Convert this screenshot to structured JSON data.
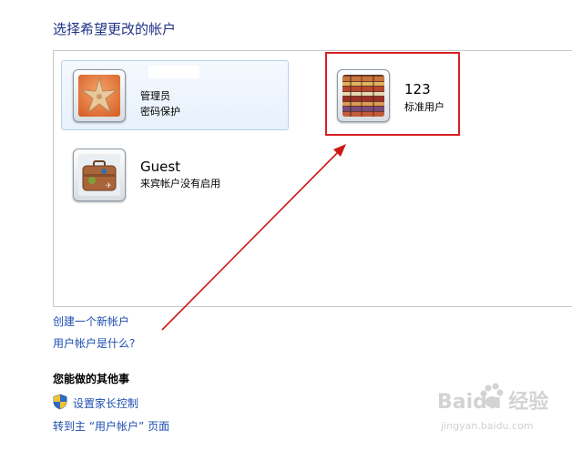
{
  "page": {
    "title": "选择希望更改的帐户"
  },
  "accounts": [
    {
      "name": "",
      "type": "管理员",
      "status": "密码保护",
      "icon": "starfish-icon",
      "selected": true
    },
    {
      "name": "123",
      "type": "标准用户",
      "icon": "colorful-books-icon",
      "highlighted": true
    },
    {
      "name": "Guest",
      "status": "来宾帐户没有启用",
      "icon": "suitcase-icon"
    }
  ],
  "links": {
    "create_account": "创建一个新帐户",
    "what_is_account": "用户帐户是什么?"
  },
  "other_tasks": {
    "heading": "您能做的其他事",
    "parental_controls": "设置家长控制",
    "goto_main": "转到主 “用户帐户” 页面"
  },
  "watermark": {
    "logo": "Baidu 经验",
    "url": "jingyan.baidu.com"
  },
  "colors": {
    "title": "#1e3287",
    "link": "#1f4fb1",
    "highlight_border": "#d62024",
    "arrow": "#cc1a1a"
  }
}
